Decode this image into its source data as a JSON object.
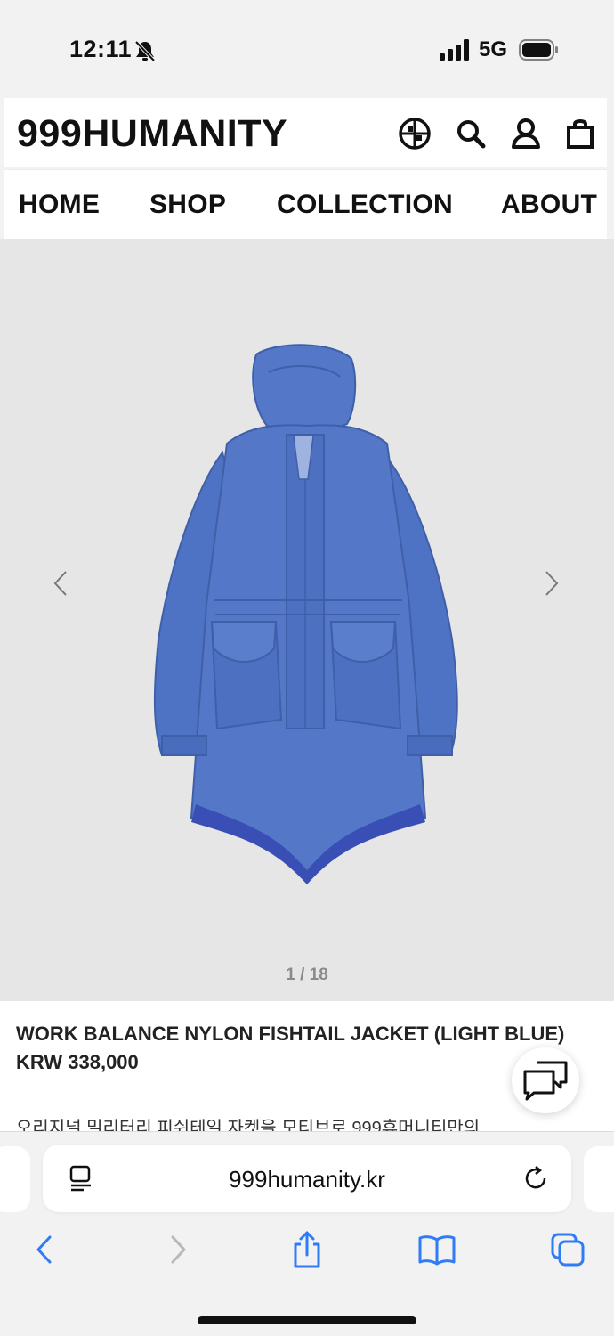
{
  "status_bar": {
    "time": "12:11",
    "network": "5G",
    "icons": [
      "bell-slash-icon",
      "signal-icon",
      "battery-icon"
    ]
  },
  "header": {
    "logo": "999HUMANITY",
    "icons": [
      "globe-icon",
      "search-icon",
      "user-icon",
      "bag-icon"
    ]
  },
  "nav": {
    "items": [
      "HOME",
      "SHOP",
      "COLLECTION",
      "ABOUT"
    ]
  },
  "gallery": {
    "counter": "1 / 18",
    "image": "product-image-blue-fishtail-jacket"
  },
  "product": {
    "title": "WORK BALANCE NYLON FISHTAIL JACKET (LIGHT BLUE)",
    "price": "KRW 338,000",
    "description": "오리지널 밀리터리 피쉬테일 자켓을 모티브로 999휴머니티만의"
  },
  "browser": {
    "url": "999humanity.kr"
  },
  "colors": {
    "accent": "#2f7cf6",
    "jacket": "#4f73c4",
    "gallery_bg": "#e6e6e6"
  }
}
